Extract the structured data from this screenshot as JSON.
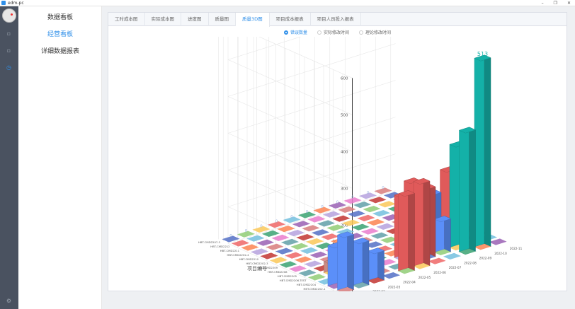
{
  "window": {
    "title": "edm-pc",
    "minimize": "–",
    "maximize": "❐",
    "close": "✕"
  },
  "rail": {
    "icons": [
      "board-icon",
      "chart-icon",
      "clock-icon",
      "settings-icon"
    ]
  },
  "menu": {
    "items": [
      "数据看板",
      "经营看板",
      "详细数据报表"
    ],
    "active_index": 1
  },
  "tabs": [
    "工时成本图",
    "实际成本图",
    "进度图",
    "质量图",
    "质量3D图",
    "项目成本报表",
    "项目人员投入报表"
  ],
  "active_tab": 4,
  "radios": [
    "错误数量",
    "实际修改时间",
    "理论修改时间"
  ],
  "active_radio": 0,
  "chart_data": {
    "type": "bar3d",
    "z_axis_label": "Z",
    "x_axis_label": "项目编号",
    "y_axis_label": "月份",
    "z_ticks": [
      0,
      100,
      200,
      300,
      400,
      500,
      600
    ],
    "zlim": [
      0,
      600
    ],
    "projects": [
      "HBT-CMD2207-3",
      "HBT-CMD2212",
      "HBT-CMD2211",
      "HBT-CMD2202-4",
      "HBT-CMD2210",
      "HBT-CMD2202-3",
      "HBT-CMD2209",
      "HBT-CMD2208",
      "HBT-CMD2205",
      "HBT-CMD2206-TEST",
      "HBT-CMD2204",
      "HBT-CMD2202-1",
      "HBT-CMD2113"
    ],
    "months": [
      "2022-01",
      "2022-02",
      "2022-03",
      "2022-04",
      "2022-05",
      "2022-06",
      "2022-07",
      "2022-08",
      "2022-09",
      "2022-10",
      "2022-11"
    ],
    "visible_labels": [
      "513",
      "30",
      "20",
      "60",
      "100",
      "0"
    ],
    "bars": [
      {
        "project": 12,
        "month": 0,
        "value": 150
      },
      {
        "project": 12,
        "month": 1,
        "value": 120
      },
      {
        "project": 11,
        "month": 1,
        "value": 100
      },
      {
        "project": 11,
        "month": 0,
        "value": 110
      },
      {
        "project": 12,
        "month": 2,
        "value": 80
      },
      {
        "project": 10,
        "month": 1,
        "value": 60
      },
      {
        "project": 9,
        "month": 1,
        "value": 30
      },
      {
        "project": 12,
        "month": 4,
        "value": 210
      },
      {
        "project": 12,
        "month": 5,
        "value": 230
      },
      {
        "project": 11,
        "month": 5,
        "value": 220
      },
      {
        "project": 11,
        "month": 6,
        "value": 190
      },
      {
        "project": 10,
        "month": 5,
        "value": 170
      },
      {
        "project": 12,
        "month": 9,
        "value": 513
      },
      {
        "project": 12,
        "month": 8,
        "value": 330
      },
      {
        "project": 11,
        "month": 8,
        "value": 280
      },
      {
        "project": 10,
        "month": 8,
        "value": 200
      },
      {
        "project": 9,
        "month": 8,
        "value": 100
      },
      {
        "project": 10,
        "month": 7,
        "value": 150
      },
      {
        "project": 9,
        "month": 7,
        "value": 120
      },
      {
        "project": 8,
        "month": 8,
        "value": 60
      },
      {
        "project": 7,
        "month": 8,
        "value": 30
      },
      {
        "project": 6,
        "month": 8,
        "value": 20
      },
      {
        "project": 11,
        "month": 7,
        "value": 90
      },
      {
        "project": 10,
        "month": 6,
        "value": 70
      }
    ]
  }
}
